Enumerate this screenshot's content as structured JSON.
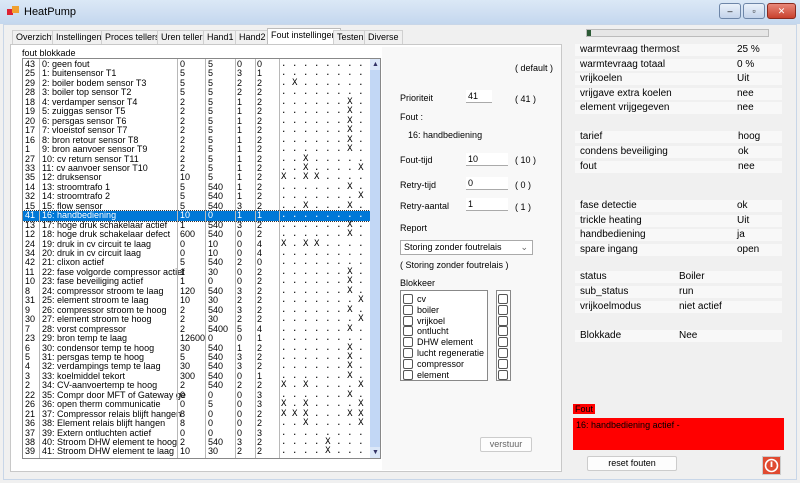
{
  "window": {
    "title": "HeatPump",
    "minimize": "–",
    "maximize": "▫",
    "close": "✕"
  },
  "tabs": [
    "Overzicht",
    "Instellingen",
    "Proces tellers",
    "Uren tellers",
    "Hand1",
    "Hand2",
    "Fout instellingen",
    "Testen",
    "Diverse"
  ],
  "active_tab": 6,
  "fout_blokkade": {
    "label": "fout blokkade",
    "selected_index": 16,
    "rows": [
      [
        "43",
        "0: geen fout",
        "0",
        "5",
        "0",
        "0",
        "........"
      ],
      [
        "25",
        "1: buitensensor T1",
        "5",
        "5",
        "3",
        "1",
        "........"
      ],
      [
        "29",
        "2: boiler bodem sensor T3",
        "5",
        "5",
        "2",
        "2",
        ".X......"
      ],
      [
        "28",
        "3: boiler top sensor T2",
        "5",
        "5",
        "2",
        "2",
        "........"
      ],
      [
        "18",
        "4: verdamper sensor T4",
        "2",
        "5",
        "1",
        "2",
        "......X."
      ],
      [
        "19",
        "5: zuiggas sensor T5",
        "2",
        "5",
        "1",
        "2",
        "......X."
      ],
      [
        "20",
        "6: persgas sensor T6",
        "2",
        "5",
        "1",
        "2",
        "......X."
      ],
      [
        "17",
        "7: vloeistof sensor T7",
        "2",
        "5",
        "1",
        "2",
        "......X."
      ],
      [
        "16",
        "8: bron retour sensor T8",
        "2",
        "5",
        "1",
        "2",
        "......X."
      ],
      [
        "1",
        "9: bron aanvoer sensor T9",
        "2",
        "5",
        "1",
        "2",
        "......X."
      ],
      [
        "27",
        "10: cv return sensor T11",
        "2",
        "5",
        "1",
        "2",
        "..X....."
      ],
      [
        "33",
        "11: cv aanvoer sensor T10",
        "2",
        "5",
        "1",
        "2",
        "..X....X"
      ],
      [
        "35",
        "12: druksensor",
        "10",
        "5",
        "1",
        "2",
        "X.XX...."
      ],
      [
        "14",
        "13: stroomtrafo 1",
        "5",
        "540",
        "1",
        "2",
        "......X."
      ],
      [
        "32",
        "14: stroomtrafo 2",
        "5",
        "540",
        "1",
        "2",
        ".......X"
      ],
      [
        "15",
        "15: flow sensor",
        "5",
        "540",
        "3",
        "2",
        "..X...X."
      ],
      [
        "41",
        "16: handbediening",
        "10",
        "0",
        "1",
        "1",
        "........"
      ],
      [
        "13",
        "17: hoge druk schakelaar actief",
        "1",
        "540",
        "3",
        "2",
        "......X."
      ],
      [
        "12",
        "18: hoge druk schakelaar defect",
        "600",
        "540",
        "0",
        "2",
        "......X."
      ],
      [
        "24",
        "19: druk in cv circuit te laag",
        "0",
        "10",
        "0",
        "4",
        "X.XX...."
      ],
      [
        "34",
        "20: druk in cv circuit laag",
        "0",
        "10",
        "0",
        "4",
        "........"
      ],
      [
        "42",
        "21: clixon actief",
        "5",
        "540",
        "2",
        "0",
        "........"
      ],
      [
        "11",
        "22: fase volgorde compressor actief",
        "1",
        "30",
        "0",
        "2",
        "......X."
      ],
      [
        "10",
        "23: fase beveiliging actief",
        "1",
        "0",
        "0",
        "2",
        "......X."
      ],
      [
        "8",
        "24: compressor stroom te laag",
        "120",
        "540",
        "3",
        "2",
        "......X."
      ],
      [
        "31",
        "25: element stroom te laag",
        "10",
        "30",
        "2",
        "2",
        ".......X"
      ],
      [
        "9",
        "26: compressor stroom te hoog",
        "2",
        "540",
        "3",
        "2",
        "......X."
      ],
      [
        "30",
        "27: element stroom te hoog",
        "2",
        "30",
        "2",
        "2",
        ".......X"
      ],
      [
        "7",
        "28: vorst compressor",
        "2",
        "5400",
        "5",
        "4",
        "......X."
      ],
      [
        "23",
        "29: bron temp te laag",
        "12600",
        "0",
        "0",
        "1",
        "........"
      ],
      [
        "6",
        "30: condensor temp te hoog",
        "30",
        "540",
        "1",
        "2",
        "......X."
      ],
      [
        "5",
        "31: persgas temp te hoog",
        "5",
        "540",
        "3",
        "2",
        "......X."
      ],
      [
        "4",
        "32: verdampings temp te laag",
        "30",
        "540",
        "3",
        "2",
        "......X."
      ],
      [
        "3",
        "33: koelmiddel tekort",
        "300",
        "540",
        "0",
        "1",
        "......X."
      ],
      [
        "2",
        "34: CV-aanvoertemp te hoog",
        "2",
        "540",
        "2",
        "2",
        "X.X....X"
      ],
      [
        "22",
        "35: Compr door MFT of Gateway ge",
        "0",
        "0",
        "0",
        "3",
        "......X."
      ],
      [
        "26",
        "36: open therm communicatie",
        "0",
        "5",
        "0",
        "3",
        "X.X....X"
      ],
      [
        "21",
        "37: Compressor relais blijft hangen",
        "8",
        "0",
        "0",
        "2",
        "XXX...XX"
      ],
      [
        "36",
        "38: Element relais blijft hangen",
        "8",
        "0",
        "0",
        "2",
        "..X....X"
      ],
      [
        "37",
        "39: Extern ontluchten actief",
        "0",
        "0",
        "0",
        "3",
        "........"
      ],
      [
        "38",
        "40: Stroom DHW element te hoog",
        "2",
        "540",
        "3",
        "2",
        "....X..."
      ],
      [
        "39",
        "41: Stroom DHW element te laag",
        "10",
        "30",
        "2",
        "2",
        "....X..."
      ]
    ]
  },
  "settings": {
    "default_label": "( default )",
    "prioriteit": {
      "label": "Prioriteit",
      "value": "41",
      "default": "( 41 )"
    },
    "fout_label": "Fout :",
    "fout_name": "16: handbediening",
    "fout_tijd": {
      "label": "Fout-tijd",
      "value": "10",
      "default": "( 10 )"
    },
    "retry_tijd": {
      "label": "Retry-tijd",
      "value": "0",
      "default": "( 0 )"
    },
    "retry_aantal": {
      "label": "Retry-aantal",
      "value": "1",
      "default": "( 1 )"
    },
    "report": {
      "label": "Report",
      "value": "Storing zonder foutrelais",
      "default": "( Storing zonder foutrelais )"
    },
    "blokkeer": {
      "label": "Blokkeer",
      "items": [
        "cv",
        "boiler",
        "vrijkoel",
        "ontlucht",
        "DHW element",
        "lucht regeneratie",
        "compressor",
        "element"
      ]
    },
    "send_button": "verstuur"
  },
  "status": {
    "progress_percent": 1,
    "group1": [
      [
        "warmtevraag thermost",
        "25 %"
      ],
      [
        "warmtevraag totaal",
        "0 %"
      ],
      [
        "vrijkoelen",
        "Uit"
      ],
      [
        "vrijgave extra koelen",
        "nee"
      ],
      [
        "element vrijgegeven",
        "nee"
      ]
    ],
    "group2": [
      [
        "tarief",
        "hoog"
      ],
      [
        "condens beveiliging",
        "ok"
      ],
      [
        "fout",
        "nee"
      ]
    ],
    "group3": [
      [
        "fase detectie",
        "ok"
      ],
      [
        "trickle heating",
        "Uit"
      ],
      [
        "handbediening",
        "ja"
      ],
      [
        "spare ingang",
        "open"
      ]
    ],
    "group4": [
      [
        "status",
        "Boiler"
      ],
      [
        "sub_status",
        "run"
      ],
      [
        "vrijkoelmodus",
        "niet actief"
      ]
    ],
    "blokkade": [
      "Blokkade",
      "Nee"
    ],
    "fout_header": "Fout",
    "fout_message": "16: handbediening actief -",
    "reset_button": "reset fouten",
    "error_color": "#ff0000"
  }
}
